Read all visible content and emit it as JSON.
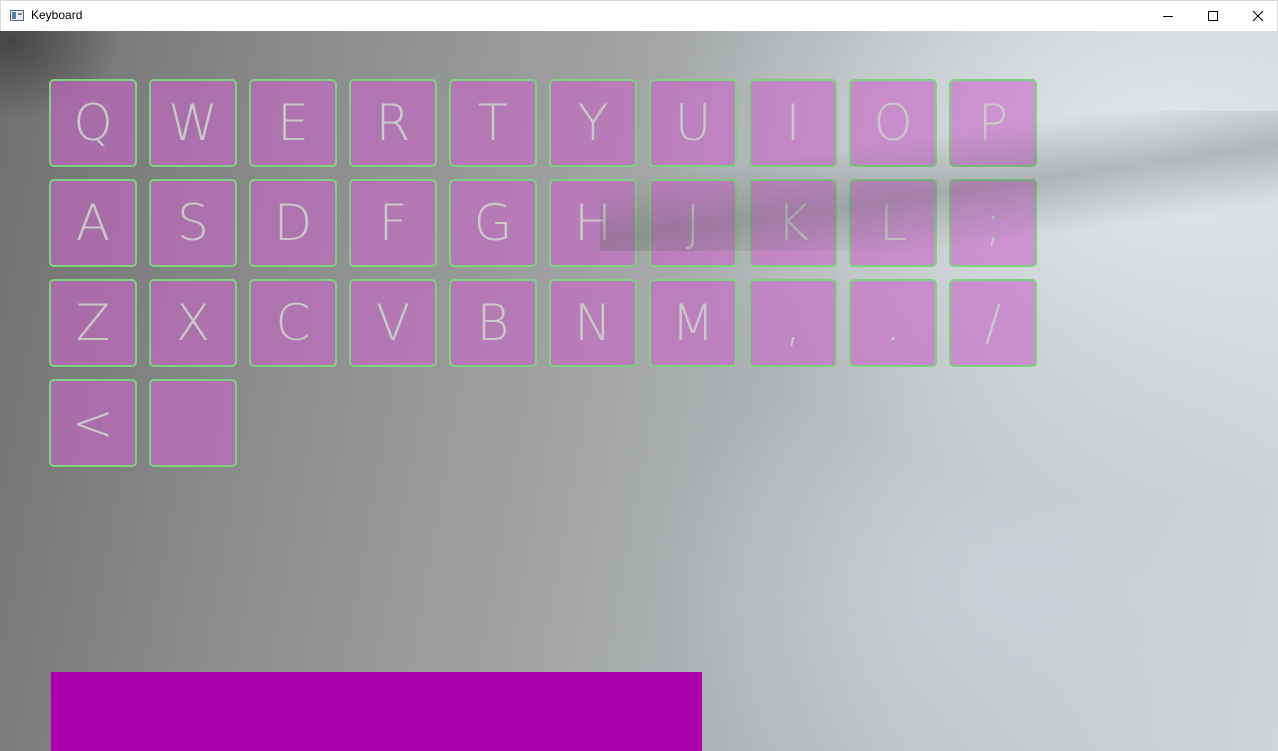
{
  "window": {
    "title": "Keyboard"
  },
  "keyboard": {
    "rows": [
      [
        "Q",
        "W",
        "E",
        "R",
        "T",
        "Y",
        "U",
        "I",
        "O",
        "P"
      ],
      [
        "A",
        "S",
        "D",
        "F",
        "G",
        "H",
        "J",
        "K",
        "L",
        ";"
      ],
      [
        "Z",
        "X",
        "C",
        "V",
        "B",
        "N",
        "M",
        ",",
        ".",
        "/"
      ],
      [
        "<",
        " "
      ]
    ]
  },
  "text_output": {
    "value": ""
  },
  "colors": {
    "key_fill": "#c864c8",
    "key_border": "#7ed17e",
    "key_text": "#c9c9c9",
    "text_box": "#ad00ad"
  }
}
